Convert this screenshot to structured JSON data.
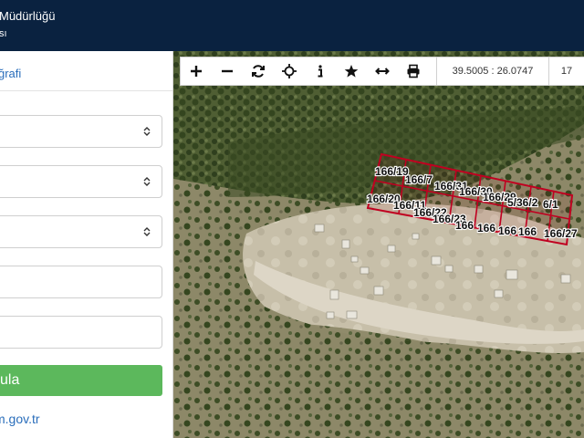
{
  "header": {
    "title_line1": " Müdürlüğü",
    "title_line2": "sı"
  },
  "sidebar": {
    "tab_label": "ğrafi",
    "fields": [
      {
        "value": ""
      },
      {
        "value": ""
      },
      {
        "value": ""
      },
      {
        "placeholder": ""
      },
      {
        "placeholder": ""
      }
    ],
    "query_button_label": "ula",
    "site_link": "m.gov.tr"
  },
  "toolbar": {
    "icons": [
      "zoom-in-icon",
      "zoom-out-icon",
      "refresh-icon",
      "locate-icon",
      "info-icon",
      "star-icon",
      "measure-icon",
      "print-icon"
    ],
    "coordinates": "39.5005 : 26.0747",
    "zoom_level": "17"
  },
  "map": {
    "parcel_color": "#c00020",
    "parcels": [
      "166/19",
      "166/7",
      "166/31",
      "166/30",
      "166/29",
      "5/36/2",
      "6/1",
      "166/20",
      "166/11",
      "166/22",
      "166/23",
      "166",
      "166",
      "166",
      "166",
      "166/27"
    ]
  }
}
